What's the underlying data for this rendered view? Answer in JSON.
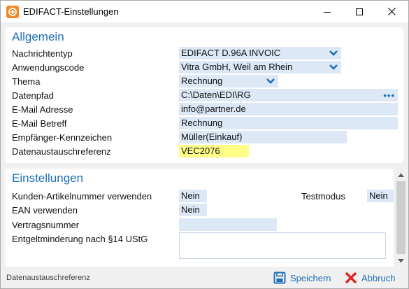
{
  "window": {
    "title": "EDIFACT-Einstellungen"
  },
  "general": {
    "title": "Allgemein",
    "rows": [
      {
        "label": "Nachrichtentyp",
        "value": "EDIFACT D.96A INVOIC"
      },
      {
        "label": "Anwendungscode",
        "value": "Vitra GmbH, Weil am Rhein"
      },
      {
        "label": "Thema",
        "value": "Rechnung"
      },
      {
        "label": "Datenpfad",
        "value": "C:\\Daten\\EDI\\RG"
      },
      {
        "label": "E-Mail Adresse",
        "value": "info@partner.de"
      },
      {
        "label": "E-Mail Betreff",
        "value": "Rechnung"
      },
      {
        "label": "Empfänger-Kennzeichen",
        "value": "Müller(Einkauf)"
      },
      {
        "label": "Datenaustauschreferenz",
        "value": "VEC2076"
      }
    ],
    "browse_label": "•••"
  },
  "settings": {
    "title": "Einstellungen",
    "customer_article": {
      "label": "Kunden-Artikelnummer verwenden",
      "value": "Nein"
    },
    "test_mode": {
      "label": "Testmodus",
      "value": "Nein"
    },
    "ean": {
      "label": "EAN verwenden",
      "value": "Nein"
    },
    "contract_number": {
      "label": "Vertragsnummer",
      "value": ""
    },
    "discount": {
      "label": "Entgeltminderung nach §14 UStG",
      "value": ""
    }
  },
  "footer": {
    "status": "Datenaustauschreferenz",
    "save_label": "Speichern",
    "cancel_label": "Abbruch"
  },
  "colors": {
    "accent": "#1e6fb8",
    "field": "#dce8f5",
    "highlight": "#ffff88",
    "cancel": "#d9261c"
  },
  "icons": [
    "app-icon",
    "minimize-icon",
    "maximize-icon",
    "close-icon",
    "chevron-down-icon",
    "save-icon",
    "cancel-icon"
  ]
}
